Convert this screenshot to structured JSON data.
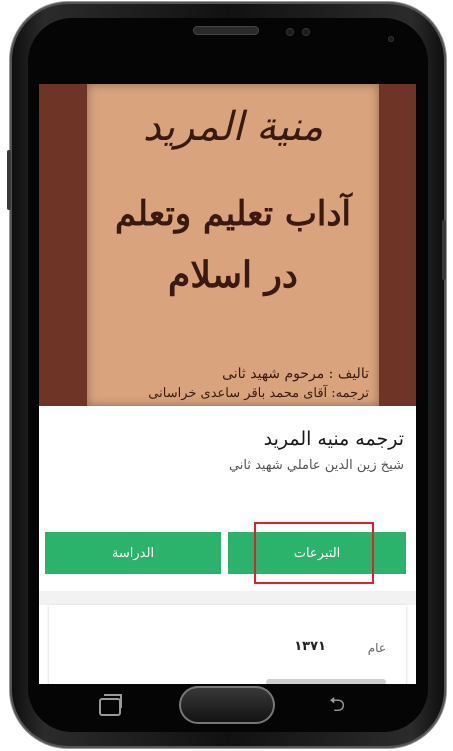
{
  "cover": {
    "title": "منیة المرید",
    "subtitle_1": "آداب تعلیم وتعلم",
    "subtitle_2": "در اسلام",
    "author_line": "تالیف : مرحوم شهید ثانی",
    "translator_line": "ترجمه: آقای محمد باقر ساعدی خراسانی"
  },
  "book": {
    "title": "ترجمه منيه المريد",
    "author": "شيخ زين الدين عاملي شهيد ثاني"
  },
  "actions": {
    "donate_label": "التبرعات",
    "study_label": "الدراسة"
  },
  "details": {
    "year_label": "عام",
    "year_value": "۱۳۷۱"
  },
  "colors": {
    "accent_green": "#2bb36b",
    "highlight_red": "#e02030",
    "cover_background": "#6e3526",
    "cover_paper": "#d9a37e"
  },
  "icons": {
    "recent_apps": "recent-apps-icon",
    "home": "home-button-icon",
    "back": "back-icon"
  }
}
